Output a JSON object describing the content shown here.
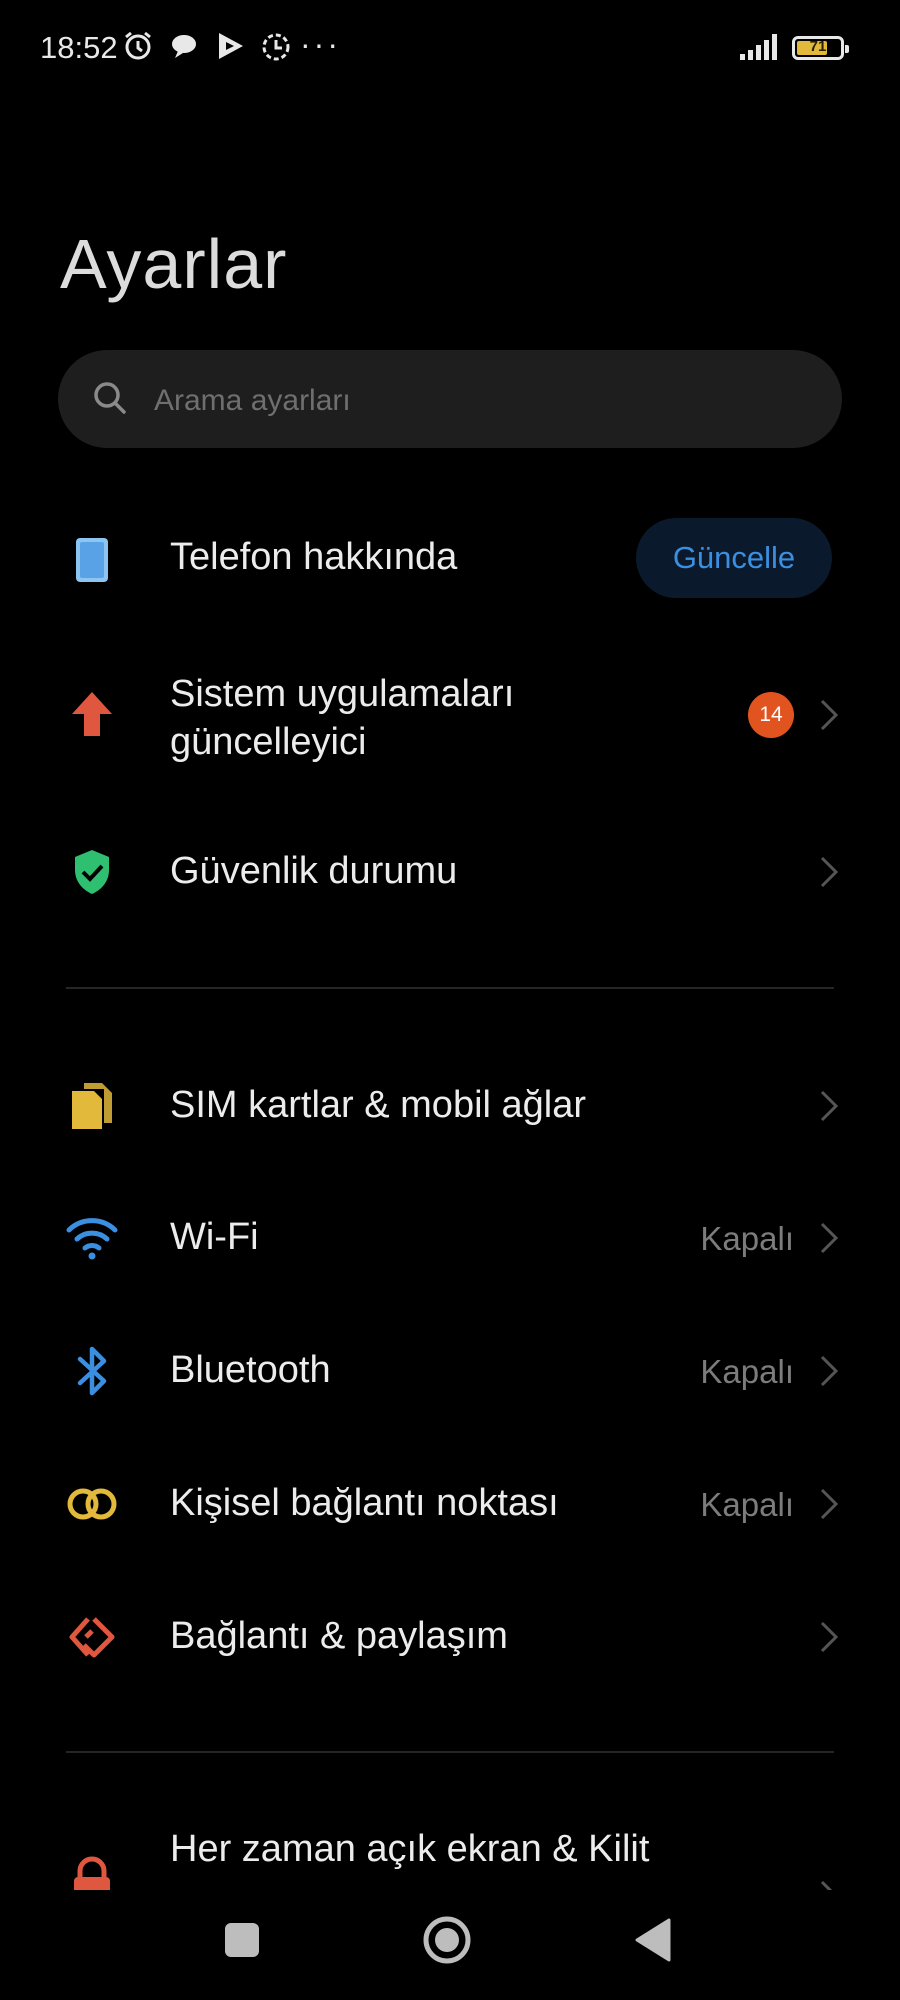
{
  "status_bar": {
    "time": "18:52",
    "battery": "71",
    "battery_level": 0.71,
    "notification_icons": [
      "alarm-icon",
      "chat-icon",
      "play-icon",
      "timer-icon"
    ],
    "overflow": "···"
  },
  "page_title": "Ayarlar",
  "search": {
    "placeholder": "Arama ayarları"
  },
  "rows": [
    {
      "label": "Telefon hakkında",
      "icon": "phone-icon",
      "action": "Güncelle"
    },
    {
      "label_line1": "Sistem uygulamaları",
      "label_line2": "güncelleyici",
      "icon": "upload-arrow-icon",
      "badge": "14"
    },
    {
      "label": "Güvenlik durumu",
      "icon": "shield-check-icon"
    },
    {
      "label": "SIM kartlar & mobil ağlar",
      "icon": "sim-card-icon"
    },
    {
      "label": "Wi-Fi",
      "icon": "wifi-icon",
      "value": "Kapalı"
    },
    {
      "label": "Bluetooth",
      "icon": "bluetooth-icon",
      "value": "Kapalı"
    },
    {
      "label": "Kişisel bağlantı noktası",
      "icon": "hotspot-icon",
      "value": "Kapalı"
    },
    {
      "label": "Bağlantı & paylaşım",
      "icon": "connection-share-icon"
    },
    {
      "label": "Her zaman açık ekran & Kilit",
      "icon": "lock-icon"
    }
  ],
  "colors": {
    "background": "#000000",
    "accent_blue": "#3b8fe0",
    "badge_orange": "#e2541f",
    "shield_green": "#2fbf71",
    "sim_yellow": "#e2b93b",
    "arrow_red": "#e0573f"
  },
  "navbar": {
    "icons": [
      "recents-square-icon",
      "home-circle-icon",
      "back-triangle-icon"
    ]
  }
}
